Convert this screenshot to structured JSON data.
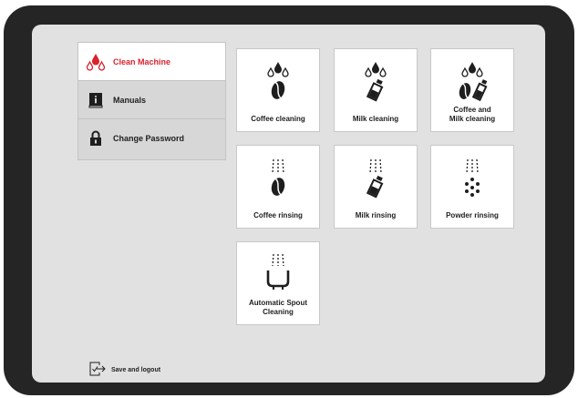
{
  "sidebar": {
    "items": [
      {
        "label": "Clean Machine",
        "icon": "drops-icon"
      },
      {
        "label": "Manuals",
        "icon": "manual-book-icon"
      },
      {
        "label": "Change Password",
        "icon": "padlock-icon"
      }
    ]
  },
  "tiles": [
    {
      "label": "Coffee cleaning",
      "icon": "coffee-cleaning-icon"
    },
    {
      "label": "Milk cleaning",
      "icon": "milk-cleaning-icon"
    },
    {
      "label": "Coffee and Milk cleaning",
      "icon": "coffee-milk-cleaning-icon"
    },
    {
      "label": "Coffee rinsing",
      "icon": "coffee-rinsing-icon"
    },
    {
      "label": "Milk rinsing",
      "icon": "milk-rinsing-icon"
    },
    {
      "label": "Powder rinsing",
      "icon": "powder-rinsing-icon"
    },
    {
      "label": "Automatic Spout Cleaning",
      "icon": "spout-cleaning-icon"
    }
  ],
  "footer": {
    "logout_label": "Save and logout",
    "icon": "logout-icon"
  },
  "colors": {
    "accent": "#d9232d",
    "bezel": "#252525",
    "screen": "#e1e1e1"
  }
}
